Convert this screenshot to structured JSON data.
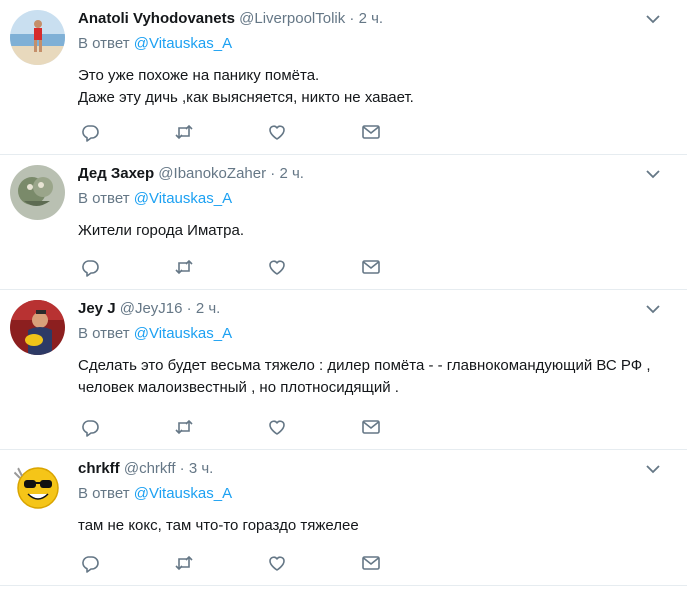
{
  "reply_prefix": "В ответ",
  "tweets": [
    {
      "fullname": "Anatoli Vyhodovanets",
      "handle": "@LiverpoolTolik",
      "dot": " · ",
      "time": "2 ч.",
      "mention": "@Vitauskas_A",
      "text": "Это уже похоже на панику помёта.\nДаже эту дичь ,как выясняется, никто не хавает."
    },
    {
      "fullname": "Дед Захер",
      "handle": "@IbanokoZaher",
      "dot": " · ",
      "time": "2 ч.",
      "mention": "@Vitauskas_A",
      "text": "Жители города Иматра."
    },
    {
      "fullname": "Jey J",
      "handle": "@JeyJ16",
      "dot": " · ",
      "time": "2 ч.",
      "mention": "@Vitauskas_A",
      "text": "Сделать это будет весьма тяжело : дилер помёта - -  главнокомандующий ВС РФ , человек малоизвестный , но плотносидящий ."
    },
    {
      "fullname": "chrkff",
      "handle": "@chrkff",
      "dot": " · ",
      "time": "3 ч.",
      "mention": "@Vitauskas_A",
      "text": "там не кокс, там что-то гораздо тяжелее"
    }
  ],
  "icons": {
    "reply": "reply-icon",
    "retweet": "retweet-icon",
    "like": "heart-icon",
    "dm": "envelope-icon",
    "caret": "chevron-down-icon"
  },
  "colors": {
    "link": "#1da1f2",
    "secondary_text": "#657786",
    "icon": "#657786",
    "divider": "#e6ecf0"
  }
}
